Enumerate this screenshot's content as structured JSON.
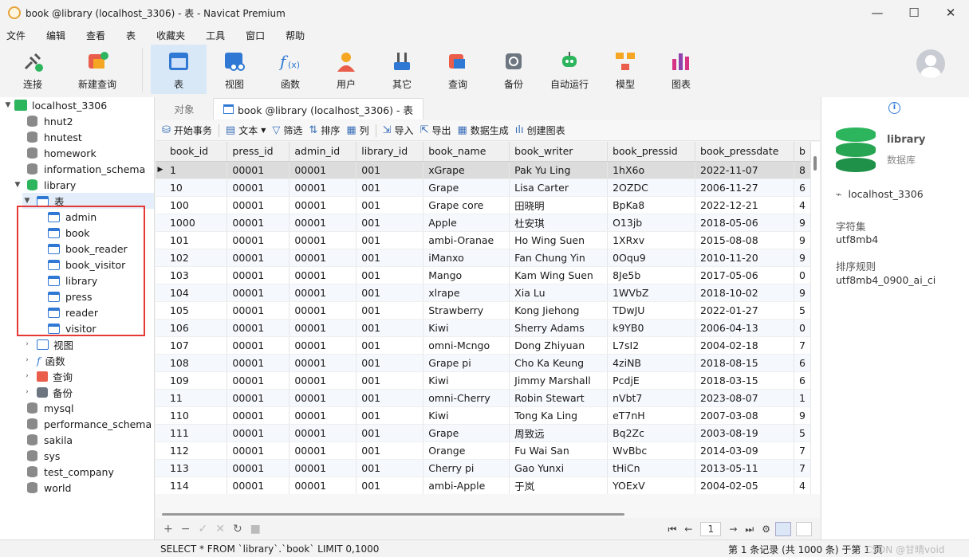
{
  "window": {
    "title": "book @library (localhost_3306) - 表 - Navicat Premium",
    "minimize": "—",
    "maximize": "☐",
    "close": "✕"
  },
  "menu": [
    "文件",
    "编辑",
    "查看",
    "表",
    "收藏夹",
    "工具",
    "窗口",
    "帮助"
  ],
  "toolbar": {
    "items": [
      {
        "label": "连接",
        "icon": "connect-icon"
      },
      {
        "label": "新建查询",
        "icon": "new-query-icon"
      },
      {
        "label": "表",
        "icon": "table-icon",
        "active": true
      },
      {
        "label": "视图",
        "icon": "view-icon"
      },
      {
        "label": "函数",
        "icon": "function-icon"
      },
      {
        "label": "用户",
        "icon": "user-icon"
      },
      {
        "label": "其它",
        "icon": "tools-icon"
      },
      {
        "label": "查询",
        "icon": "query-icon"
      },
      {
        "label": "备份",
        "icon": "backup-icon"
      },
      {
        "label": "自动运行",
        "icon": "robot-icon"
      },
      {
        "label": "模型",
        "icon": "model-icon"
      },
      {
        "label": "图表",
        "icon": "chart-icon"
      }
    ]
  },
  "sidebar": {
    "connection": "localhost_3306",
    "dbs_top": [
      "hnut2",
      "hnutest",
      "homework",
      "information_schema"
    ],
    "open_db": "library",
    "tables_group": "表",
    "tables": [
      "admin",
      "book",
      "book_reader",
      "book_visitor",
      "library",
      "press",
      "reader",
      "visitor"
    ],
    "groups": [
      "视图",
      "函数",
      "查询",
      "备份"
    ],
    "dbs_bottom": [
      "mysql",
      "performance_schema",
      "sakila",
      "sys",
      "test_company",
      "world"
    ]
  },
  "tabs": {
    "objects": "对象",
    "active": "book @library (localhost_3306) - 表"
  },
  "subtoolbar": [
    "开始事务",
    "文本",
    "筛选",
    "排序",
    "列",
    "导入",
    "导出",
    "数据生成",
    "创建图表"
  ],
  "grid": {
    "columns": [
      "book_id",
      "press_id",
      "admin_id",
      "library_id",
      "book_name",
      "book_writer",
      "book_pressid",
      "book_pressdate",
      "b"
    ],
    "rows": [
      [
        "1",
        "00001",
        "00001",
        "001",
        "xGrape",
        "Pak Yu Ling",
        "1hX6o",
        "2022-11-07",
        "8"
      ],
      [
        "10",
        "00001",
        "00001",
        "001",
        "Grape",
        "Lisa Carter",
        "2OZDC",
        "2006-11-27",
        "6"
      ],
      [
        "100",
        "00001",
        "00001",
        "001",
        "Grape core",
        "田晓明",
        "BpKa8",
        "2022-12-21",
        "4"
      ],
      [
        "1000",
        "00001",
        "00001",
        "001",
        "Apple",
        "杜安琪",
        "O13jb",
        "2018-05-06",
        "9"
      ],
      [
        "101",
        "00001",
        "00001",
        "001",
        "ambi-Oranae",
        "Ho Wing Suen",
        "1XRxv",
        "2015-08-08",
        "9"
      ],
      [
        "102",
        "00001",
        "00001",
        "001",
        "iManxo",
        "Fan Chung Yin",
        "0Oqu9",
        "2010-11-20",
        "9"
      ],
      [
        "103",
        "00001",
        "00001",
        "001",
        "Mango",
        "Kam Wing Suen",
        "8Je5b",
        "2017-05-06",
        "0"
      ],
      [
        "104",
        "00001",
        "00001",
        "001",
        "xlrape",
        "Xia Lu",
        "1WVbZ",
        "2018-10-02",
        "9"
      ],
      [
        "105",
        "00001",
        "00001",
        "001",
        "Strawberry",
        "Kong Jiehong",
        "TDwJU",
        "2022-01-27",
        "5"
      ],
      [
        "106",
        "00001",
        "00001",
        "001",
        "Kiwi",
        "Sherry Adams",
        "k9YB0",
        "2006-04-13",
        "0"
      ],
      [
        "107",
        "00001",
        "00001",
        "001",
        "omni-Mcngo",
        "Dong Zhiyuan",
        "L7sI2",
        "2004-02-18",
        "7"
      ],
      [
        "108",
        "00001",
        "00001",
        "001",
        "Grape pi",
        "Cho Ka Keung",
        "4ziNB",
        "2018-08-15",
        "6"
      ],
      [
        "109",
        "00001",
        "00001",
        "001",
        "Kiwi",
        "Jimmy Marshall",
        "PcdjE",
        "2018-03-15",
        "6"
      ],
      [
        "11",
        "00001",
        "00001",
        "001",
        "omni-Cherry",
        "Robin Stewart",
        "nVbt7",
        "2023-08-07",
        "1"
      ],
      [
        "110",
        "00001",
        "00001",
        "001",
        "Kiwi",
        "Tong Ka Ling",
        "eT7nH",
        "2007-03-08",
        "9"
      ],
      [
        "111",
        "00001",
        "00001",
        "001",
        "Grape",
        "周致远",
        "Bq2Zc",
        "2003-08-19",
        "5"
      ],
      [
        "112",
        "00001",
        "00001",
        "001",
        "Orange",
        "Fu Wai San",
        "WvBbc",
        "2014-03-09",
        "7"
      ],
      [
        "113",
        "00001",
        "00001",
        "001",
        "Cherry pi",
        "Gao Yunxi",
        "tHiCn",
        "2013-05-11",
        "7"
      ],
      [
        "114",
        "00001",
        "00001",
        "001",
        "ambi-Apple",
        "于岚",
        "YOExV",
        "2004-02-05",
        "4"
      ]
    ]
  },
  "bottombar": {
    "page": "1"
  },
  "rightpanel": {
    "db_name": "library",
    "db_type": "数据库",
    "connection": "localhost_3306",
    "charset_label": "字符集",
    "charset": "utf8mb4",
    "collation_label": "排序规则",
    "collation": "utf8mb4_0900_ai_ci"
  },
  "status": {
    "sql": "SELECT * FROM `library`.`book` LIMIT 0,1000",
    "records": "第 1 条记录 (共 1000 条) 于第 1 页",
    "watermark": "CSDN @甘晴void"
  },
  "colors": {
    "accent": "#2f78d4",
    "db_green": "#2db55d",
    "highlight_box": "#e53935"
  }
}
